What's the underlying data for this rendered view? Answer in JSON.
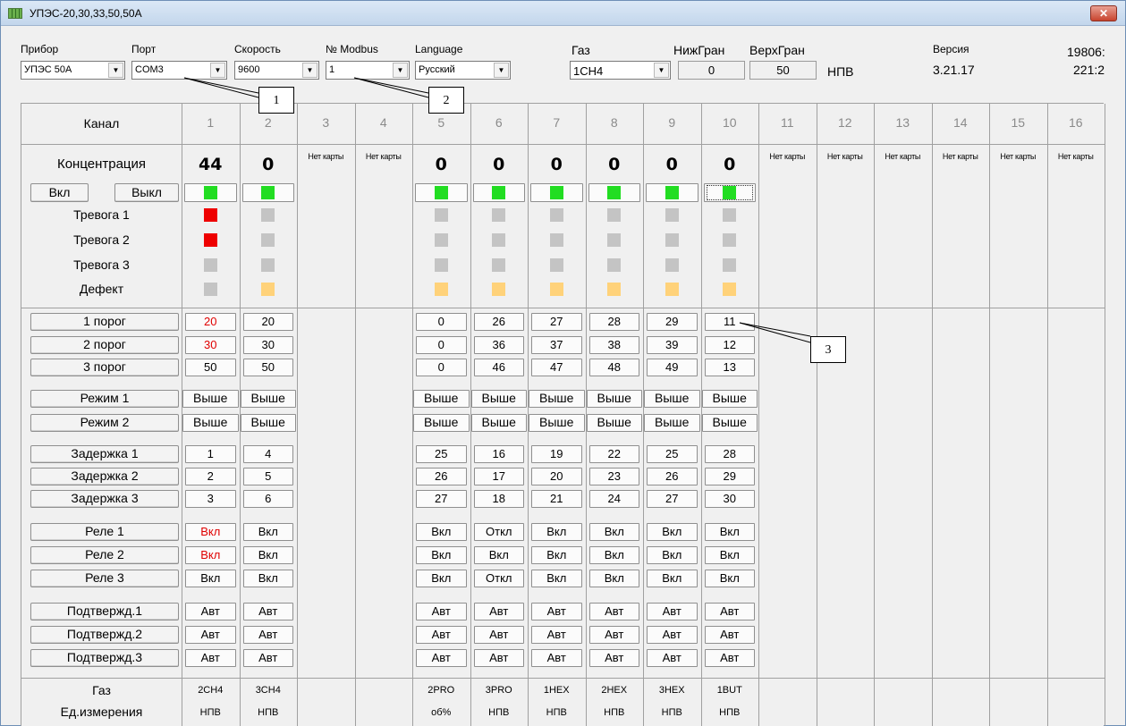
{
  "window": {
    "title": "УПЭС-20,30,33,50,50А",
    "close_glyph": "✕"
  },
  "top": {
    "device": {
      "label": "Прибор",
      "value": "УПЭС 50А"
    },
    "port": {
      "label": "Порт",
      "value": "COM3"
    },
    "speed": {
      "label": "Скорость",
      "value": "9600"
    },
    "modbus": {
      "label": "№ Modbus",
      "value": "1"
    },
    "language": {
      "label": "Language",
      "value": "Русский"
    },
    "gas": {
      "label": "Газ",
      "value": "1CH4"
    },
    "low_limit": {
      "label": "НижГран",
      "value": "0"
    },
    "high_limit": {
      "label": "ВерхГран",
      "value": "50"
    },
    "unit": "НПВ",
    "version": {
      "label": "Версия",
      "value": "3.21.17"
    },
    "serial_1": "19806:",
    "serial_2": "221:2"
  },
  "labels": {
    "channel": "Канал",
    "concentration": "Концентрация",
    "on": "Вкл",
    "off": "Выкл",
    "alarm1": "Тревога 1",
    "alarm2": "Тревога 2",
    "alarm3": "Тревога 3",
    "defect": "Дефект",
    "thr1": "1 порог",
    "thr2": "2 порог",
    "thr3": "3 порог",
    "mode1": "Режим 1",
    "mode2": "Режим 2",
    "delay1": "Задержка 1",
    "delay2": "Задержка 2",
    "delay3": "Задержка 3",
    "relay1": "Реле 1",
    "relay2": "Реле 2",
    "relay3": "Реле 3",
    "confirm1": "Подтвержд.1",
    "confirm2": "Подтвержд.2",
    "confirm3": "Подтвержд.3",
    "gas": "Газ",
    "unit": "Ед.измерения"
  },
  "no_card": "Нет карты",
  "channels": [
    {
      "n": "1",
      "card": true,
      "conc": "44",
      "status": "green",
      "a1": "red",
      "a2": "red",
      "a3": "gray",
      "defect": "gray",
      "thr": [
        "20",
        "30",
        "50"
      ],
      "thr_red": [
        true,
        true,
        false
      ],
      "mode": [
        "Выше",
        "Выше"
      ],
      "delay": [
        "1",
        "2",
        "3"
      ],
      "relay": [
        "Вкл",
        "Вкл",
        "Вкл"
      ],
      "relay_red": [
        true,
        true,
        false
      ],
      "confirm": [
        "Авт",
        "Авт",
        "Авт"
      ],
      "gas": "2CH4",
      "unit": "НПВ"
    },
    {
      "n": "2",
      "card": true,
      "conc": "0",
      "status": "green",
      "a1": "gray",
      "a2": "gray",
      "a3": "gray",
      "defect": "orange",
      "thr": [
        "20",
        "30",
        "50"
      ],
      "thr_red": [
        false,
        false,
        false
      ],
      "mode": [
        "Выше",
        "Выше"
      ],
      "delay": [
        "4",
        "5",
        "6"
      ],
      "relay": [
        "Вкл",
        "Вкл",
        "Вкл"
      ],
      "relay_red": [
        false,
        false,
        false
      ],
      "confirm": [
        "Авт",
        "Авт",
        "Авт"
      ],
      "gas": "3CH4",
      "unit": "НПВ"
    },
    {
      "n": "3",
      "card": false
    },
    {
      "n": "4",
      "card": false
    },
    {
      "n": "5",
      "card": true,
      "conc": "0",
      "status": "green",
      "a1": "gray",
      "a2": "gray",
      "a3": "gray",
      "defect": "orange",
      "thr": [
        "0",
        "0",
        "0"
      ],
      "thr_red": [
        false,
        false,
        false
      ],
      "mode": [
        "Выше",
        "Выше"
      ],
      "delay": [
        "25",
        "26",
        "27"
      ],
      "relay": [
        "Вкл",
        "Вкл",
        "Вкл"
      ],
      "relay_red": [
        false,
        false,
        false
      ],
      "confirm": [
        "Авт",
        "Авт",
        "Авт"
      ],
      "gas": "2PRO",
      "unit": "об%"
    },
    {
      "n": "6",
      "card": true,
      "conc": "0",
      "status": "green",
      "a1": "gray",
      "a2": "gray",
      "a3": "gray",
      "defect": "orange",
      "thr": [
        "26",
        "36",
        "46"
      ],
      "thr_red": [
        false,
        false,
        false
      ],
      "mode": [
        "Выше",
        "Выше"
      ],
      "delay": [
        "16",
        "17",
        "18"
      ],
      "relay": [
        "Откл",
        "Вкл",
        "Откл"
      ],
      "relay_red": [
        false,
        false,
        false
      ],
      "confirm": [
        "Авт",
        "Авт",
        "Авт"
      ],
      "gas": "3PRO",
      "unit": "НПВ"
    },
    {
      "n": "7",
      "card": true,
      "conc": "0",
      "status": "green",
      "a1": "gray",
      "a2": "gray",
      "a3": "gray",
      "defect": "orange",
      "thr": [
        "27",
        "37",
        "47"
      ],
      "thr_red": [
        false,
        false,
        false
      ],
      "mode": [
        "Выше",
        "Выше"
      ],
      "delay": [
        "19",
        "20",
        "21"
      ],
      "relay": [
        "Вкл",
        "Вкл",
        "Вкл"
      ],
      "relay_red": [
        false,
        false,
        false
      ],
      "confirm": [
        "Авт",
        "Авт",
        "Авт"
      ],
      "gas": "1HEX",
      "unit": "НПВ"
    },
    {
      "n": "8",
      "card": true,
      "conc": "0",
      "status": "green",
      "a1": "gray",
      "a2": "gray",
      "a3": "gray",
      "defect": "orange",
      "thr": [
        "28",
        "38",
        "48"
      ],
      "thr_red": [
        false,
        false,
        false
      ],
      "mode": [
        "Выше",
        "Выше"
      ],
      "delay": [
        "22",
        "23",
        "24"
      ],
      "relay": [
        "Вкл",
        "Вкл",
        "Вкл"
      ],
      "relay_red": [
        false,
        false,
        false
      ],
      "confirm": [
        "Авт",
        "Авт",
        "Авт"
      ],
      "gas": "2HEX",
      "unit": "НПВ"
    },
    {
      "n": "9",
      "card": true,
      "conc": "0",
      "status": "green",
      "a1": "gray",
      "a2": "gray",
      "a3": "gray",
      "defect": "orange",
      "thr": [
        "29",
        "39",
        "49"
      ],
      "thr_red": [
        false,
        false,
        false
      ],
      "mode": [
        "Выше",
        "Выше"
      ],
      "delay": [
        "25",
        "26",
        "27"
      ],
      "relay": [
        "Вкл",
        "Вкл",
        "Вкл"
      ],
      "relay_red": [
        false,
        false,
        false
      ],
      "confirm": [
        "Авт",
        "Авт",
        "Авт"
      ],
      "gas": "3HEX",
      "unit": "НПВ"
    },
    {
      "n": "10",
      "card": true,
      "conc": "0",
      "status": "green",
      "a1": "gray",
      "a2": "gray",
      "a3": "gray",
      "defect": "orange",
      "thr": [
        "11",
        "12",
        "13"
      ],
      "thr_red": [
        false,
        false,
        false
      ],
      "mode": [
        "Выше",
        "Выше"
      ],
      "delay": [
        "28",
        "29",
        "30"
      ],
      "relay": [
        "Вкл",
        "Вкл",
        "Вкл"
      ],
      "relay_red": [
        false,
        false,
        false
      ],
      "confirm": [
        "Авт",
        "Авт",
        "Авт"
      ],
      "gas": "1BUT",
      "unit": "НПВ"
    },
    {
      "n": "11",
      "card": false
    },
    {
      "n": "12",
      "card": false
    },
    {
      "n": "13",
      "card": false
    },
    {
      "n": "14",
      "card": false
    },
    {
      "n": "15",
      "card": false
    },
    {
      "n": "16",
      "card": false
    }
  ],
  "callouts": [
    "1",
    "2",
    "3"
  ]
}
